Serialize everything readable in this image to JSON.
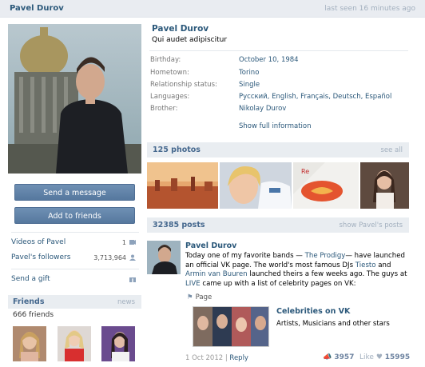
{
  "header": {
    "name": "Pavel Durov",
    "last_seen": "last seen 16 minutes ago"
  },
  "profile": {
    "name": "Pavel Durov",
    "status": "Qui audet adipiscitur",
    "info": [
      {
        "label": "Birthday:",
        "value": "October 10, 1984"
      },
      {
        "label": "Hometown:",
        "value": "Torino"
      },
      {
        "label": "Relationship status:",
        "value": "Single"
      },
      {
        "label": "Languages:",
        "value": "Русский, English, Français, Deutsch, Español"
      },
      {
        "label": "Brother:",
        "value": "Nikolay Durov"
      }
    ],
    "show_full": "Show full information"
  },
  "actions": {
    "send_message": "Send a message",
    "add_friend": "Add to friends"
  },
  "left_links": {
    "videos": {
      "label": "Videos of Pavel",
      "count": "1"
    },
    "followers": {
      "label": "Pavel's followers",
      "count": "3,713,964"
    },
    "gift": {
      "label": "Send a gift"
    }
  },
  "friends": {
    "title": "Friends",
    "news": "news",
    "count": "666 friends"
  },
  "photos": {
    "title": "125 photos",
    "see_all": "see all"
  },
  "posts": {
    "title": "32385 posts",
    "show": "show Pavel's posts"
  },
  "post": {
    "author": "Pavel Durov",
    "line1_a": "Today one of my favorite bands — ",
    "line1_link": "The Prodigy",
    "line1_b": "— have launched",
    "line2_a": "an official VK page. The world's most famous DJs ",
    "line2_link": "Tiesto",
    "line2_b": " and",
    "line3_link": "Armin van Buuren",
    "line3_b": " launched theirs a few weeks ago. The guys at",
    "line4_link": "LIVE",
    "line4_b": " came up with a list of celebrity pages on VK:",
    "page_tag": "Page",
    "attachment_title": "Celebrities on VK",
    "attachment_sub": "Artists, Musicians and other stars",
    "date": "1 Oct 2012",
    "reply": "Reply",
    "reposts": "3957",
    "like_label": "Like",
    "likes": "15995"
  },
  "colors": {
    "link": "#2b587a",
    "button": "#5b7da3",
    "section_bg": "#e9edf1"
  }
}
